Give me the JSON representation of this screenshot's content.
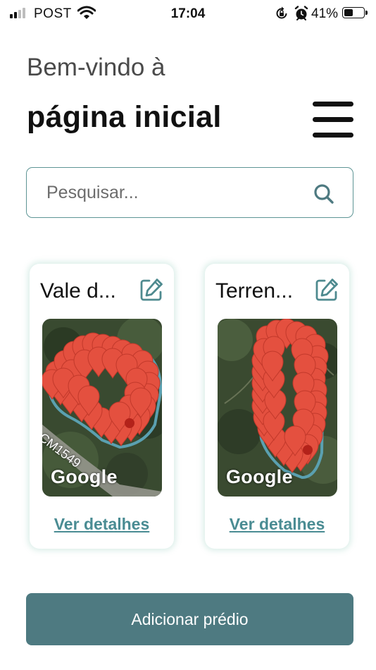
{
  "status_bar": {
    "carrier": "POST",
    "time": "17:04",
    "battery_percent": "41%",
    "battery_level": 0.41,
    "icons": [
      "signal-icon",
      "wifi-icon",
      "rotation-lock-icon",
      "alarm-icon",
      "battery-icon"
    ]
  },
  "header": {
    "greeting": "Bem-vindo à",
    "title": "página inicial",
    "menu_icon": "hamburger-menu-icon"
  },
  "search": {
    "placeholder": "Pesquisar...",
    "value": "",
    "icon": "search-icon"
  },
  "properties": [
    {
      "name": "Vale d...",
      "map_attribution": "Google",
      "road_label": "CM1549",
      "details_link": "Ver detalhes",
      "edit_icon": "edit-icon"
    },
    {
      "name": "Terren...",
      "map_attribution": "Google",
      "details_link": "Ver detalhes",
      "edit_icon": "edit-icon"
    }
  ],
  "actions": {
    "add_building": "Adicionar prédio"
  },
  "colors": {
    "accent": "#4e7a81",
    "link": "#4a8c93",
    "pin": "#e4503f",
    "boundary": "#5aa0b0"
  }
}
